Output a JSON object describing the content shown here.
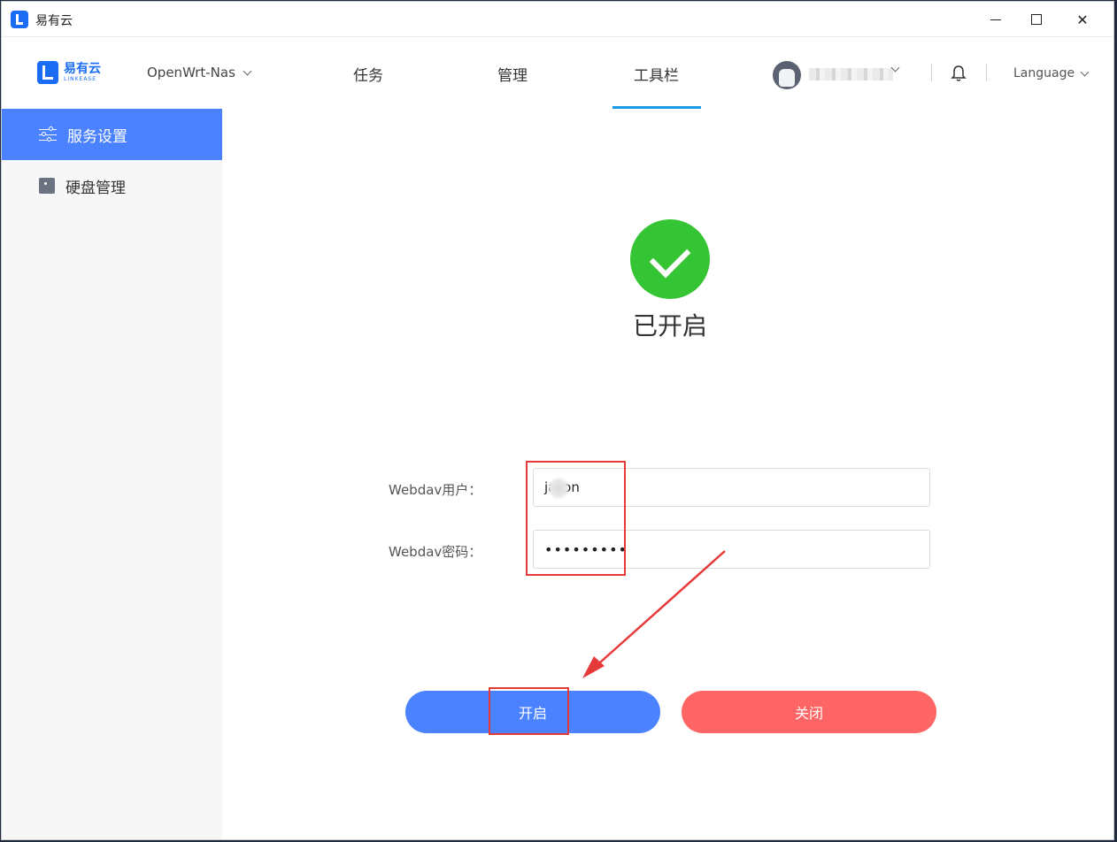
{
  "window": {
    "title": "易有云",
    "min_icon": "minimize-icon",
    "max_icon": "maximize-icon",
    "close_glyph": "✕"
  },
  "header": {
    "logo_cn": "易有云",
    "logo_en": "LINKEASE",
    "device": "OpenWrt-Nas",
    "tabs": [
      {
        "label": "任务"
      },
      {
        "label": "管理"
      },
      {
        "label": "工具栏"
      }
    ],
    "active_tab": "工具栏",
    "language": "Language"
  },
  "sidebar": {
    "items": [
      {
        "label": "服务设置",
        "icon": "sliders-icon",
        "active": true
      },
      {
        "label": "硬盘管理",
        "icon": "disk-icon",
        "active": false
      }
    ]
  },
  "main": {
    "status_text": "已开启",
    "form": {
      "user_label": "Webdav用户：",
      "user_value": "jason",
      "password_label": "Webdav密码：",
      "password_value": "•••••••••"
    },
    "buttons": {
      "open": "开启",
      "close": "关闭"
    }
  },
  "colors": {
    "accent": "#4b82ff",
    "danger": "#ff6565",
    "success": "#35c434",
    "annotation": "#e5393a"
  }
}
